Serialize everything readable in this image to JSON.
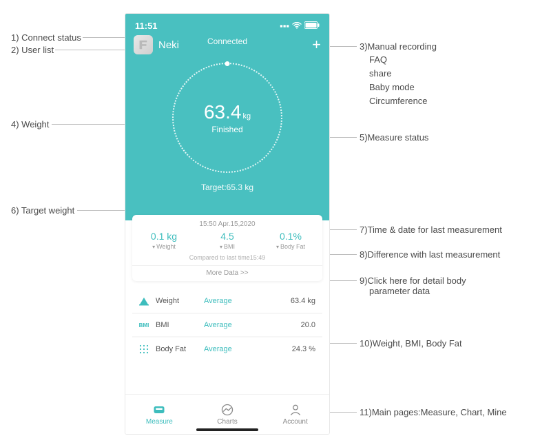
{
  "status_bar": {
    "time": "11:51"
  },
  "header": {
    "username": "Neki",
    "connect_status": "Connected",
    "plus": "+"
  },
  "dial": {
    "weight_value": "63.4",
    "weight_unit": "kg",
    "measure_status": "Finished"
  },
  "target": "Target:65.3 kg",
  "card": {
    "timestamp": "15:50 Apr.15,2020",
    "cols": [
      {
        "value": "0.1 kg",
        "label": "Weight"
      },
      {
        "value": "4.5",
        "label": "BMI"
      },
      {
        "value": "0.1%",
        "label": "Body Fat"
      }
    ],
    "compared": "Compared to last time15:49",
    "more": "More Data >>"
  },
  "metrics": [
    {
      "name": "Weight",
      "status": "Average",
      "value": "63.4 kg",
      "icon": "weight-icon"
    },
    {
      "name": "BMI",
      "status": "Average",
      "value": "20.0",
      "icon": "bmi-text"
    },
    {
      "name": "Body Fat",
      "status": "Average",
      "value": "24.3 %",
      "icon": "bodyfat-icon"
    }
  ],
  "tabs": {
    "measure": "Measure",
    "charts": "Charts",
    "account": "Account"
  },
  "annotations": {
    "a1": "1) Connect status",
    "a2": "2) User list",
    "a3": "3)Manual recording",
    "a3b": "FAQ",
    "a3c": "share",
    "a3d": "Baby mode",
    "a3e": "Circumference",
    "a4": "4) Weight",
    "a5": "5)Measure status",
    "a6": "6) Target weight",
    "a7": "7)Time & date for last measurement",
    "a8": "8)Difference with last measurement",
    "a9": "9)Click here for detail body",
    "a9b": "parameter data",
    "a10": "10)Weight, BMI, Body Fat",
    "a11": "11)Main pages:Measure, Chart, Mine"
  }
}
